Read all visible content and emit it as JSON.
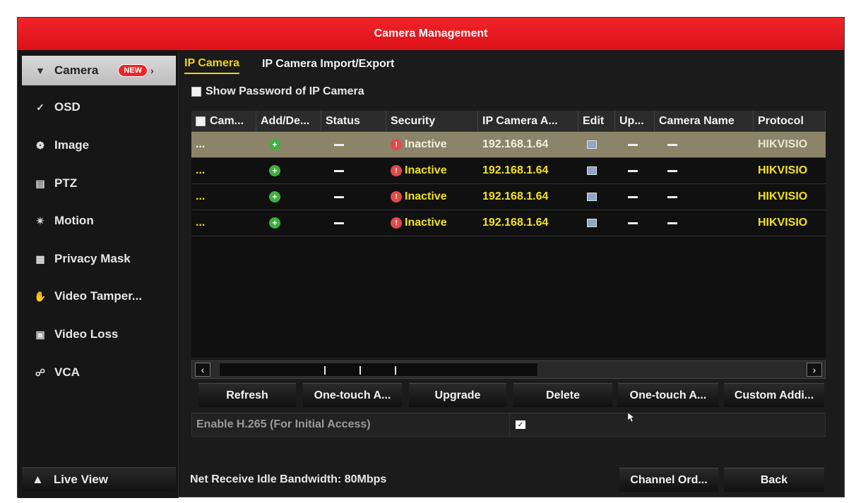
{
  "window": {
    "title": "Camera Management"
  },
  "sidebar": {
    "items": [
      {
        "label": "Camera",
        "icon": "camera-icon",
        "active": true,
        "badge": "NEW"
      },
      {
        "label": "OSD",
        "icon": "osd-icon"
      },
      {
        "label": "Image",
        "icon": "image-icon"
      },
      {
        "label": "PTZ",
        "icon": "ptz-icon"
      },
      {
        "label": "Motion",
        "icon": "motion-icon"
      },
      {
        "label": "Privacy Mask",
        "icon": "privacy-mask-icon"
      },
      {
        "label": "Video Tamper...",
        "icon": "video-tamper-icon"
      },
      {
        "label": "Video Loss",
        "icon": "video-loss-icon"
      },
      {
        "label": "VCA",
        "icon": "vca-icon"
      }
    ],
    "live_view": "Live View"
  },
  "tabs": [
    "IP Camera",
    "IP Camera Import/Export"
  ],
  "show_password": "Show Password of IP Camera",
  "table": {
    "headers": [
      "Cam...",
      "Add/De...",
      "Status",
      "Security",
      "IP Camera A...",
      "Edit",
      "Up...",
      "Camera Name",
      "Protocol"
    ],
    "rows": [
      {
        "cam": "...",
        "security": "Inactive",
        "ip": "192.168.1.64",
        "protocol": "HIKVISIO"
      },
      {
        "cam": "...",
        "security": "Inactive",
        "ip": "192.168.1.64",
        "protocol": "HIKVISIO"
      },
      {
        "cam": "...",
        "security": "Inactive",
        "ip": "192.168.1.64",
        "protocol": "HIKVISIO"
      },
      {
        "cam": "...",
        "security": "Inactive",
        "ip": "192.168.1.64",
        "protocol": "HIKVISIO"
      }
    ]
  },
  "buttons": {
    "refresh": "Refresh",
    "one_touch_1": "One-touch A...",
    "upgrade": "Upgrade",
    "delete": "Delete",
    "one_touch_2": "One-touch A...",
    "custom_add": "Custom Addi...",
    "channel_order": "Channel Ord...",
    "back": "Back"
  },
  "h265": {
    "label": "Enable H.265 (For Initial Access)",
    "checked": true
  },
  "bandwidth": "Net Receive Idle Bandwidth: 80Mbps",
  "colors": {
    "title_red": "#e0181e",
    "accent_yellow": "#f0d21a",
    "selected_row": "#8c8469"
  }
}
